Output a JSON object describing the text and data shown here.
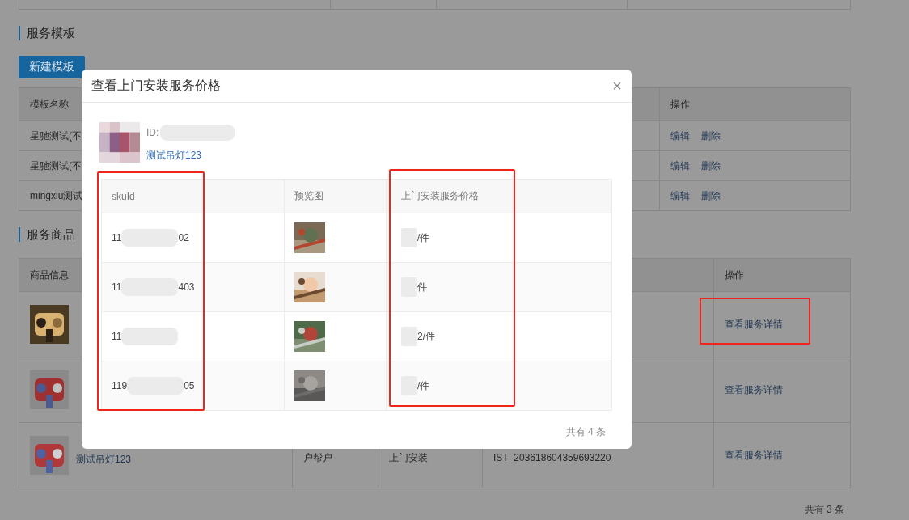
{
  "template_section": {
    "title": "服务模板",
    "new_button": "新建模板",
    "columns": [
      "模板名称",
      "操作"
    ],
    "rows": [
      {
        "name": "星驰测试(不",
        "actions": [
          "编辑",
          "删除"
        ]
      },
      {
        "name": "星驰测试(不",
        "actions": [
          "编辑",
          "删除"
        ]
      },
      {
        "name": "mingxiu测试",
        "actions": [
          "编辑",
          "删除"
        ]
      }
    ]
  },
  "product_section": {
    "title": "服务商品",
    "header": {
      "column_1": "商品信息",
      "column_5": "操作"
    },
    "rows": [
      {
        "kind": "picture",
        "action": "查看服务详情"
      },
      {
        "kind": "picture",
        "action": "查看服务详情"
      },
      {
        "kind": "picture",
        "name": "测试吊灯123",
        "column_2": "户帮户",
        "column_3": "上门安装",
        "column_4": "IST_203618604359693220",
        "action": "查看服务详情"
      }
    ],
    "total": "共有 3 条"
  },
  "dialog": {
    "title": "查看上门安装服务价格",
    "close": "×",
    "product": {
      "kind": "picture",
      "id_label": "ID:",
      "name": "测试吊灯123"
    },
    "columns": [
      "skuId",
      "预览图",
      "上门安装服务价格"
    ],
    "rows": [
      {
        "sku_start": "11",
        "sku_end": "02",
        "kind": "picture",
        "price": "/件"
      },
      {
        "sku_start": "11",
        "sku_end": "403",
        "kind": "picture",
        "price": "件"
      },
      {
        "sku_start": "11",
        "kind": "picture",
        "price": "2/件"
      },
      {
        "sku_start": "119",
        "sku_end": "05",
        "kind": "picture",
        "price": "/件"
      }
    ],
    "total": "共有 4 条"
  }
}
